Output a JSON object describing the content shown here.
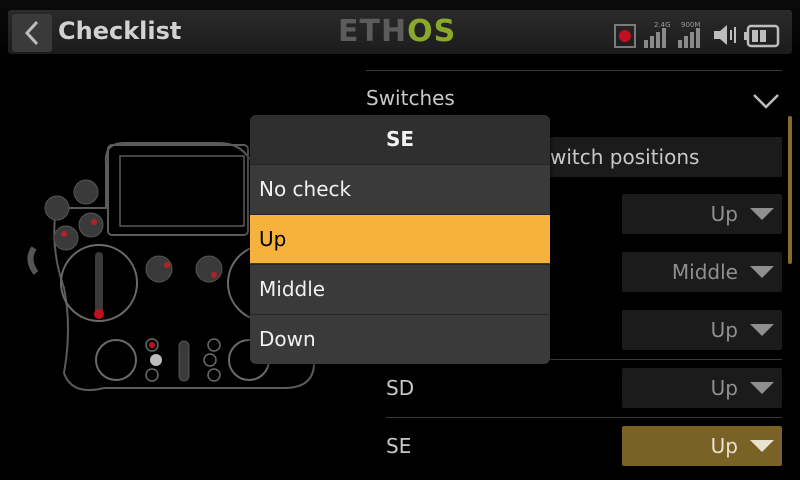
{
  "header": {
    "title": "Checklist",
    "logo_main": "ETH",
    "logo_accent": "OS",
    "signal_24": "2.4G",
    "signal_900": "900M",
    "icons": [
      "back-arrow-icon",
      "record-icon",
      "signal-2-4g-icon",
      "signal-900m-icon",
      "speaker-icon",
      "battery-icon"
    ]
  },
  "section": {
    "label": "Switches",
    "partial_row_text": "witch positions"
  },
  "rows": [
    {
      "label": "",
      "value": "Up"
    },
    {
      "label": "",
      "value": "Middle"
    },
    {
      "label": "",
      "value": "Up"
    },
    {
      "label": "SD",
      "value": "Up"
    },
    {
      "label": "SE",
      "value": "Up",
      "active": true
    }
  ],
  "popup": {
    "title": "SE",
    "options": [
      "No check",
      "Up",
      "Middle",
      "Down"
    ],
    "selected": "Up"
  },
  "colors": {
    "accent": "#f6b23a",
    "active_dropdown": "#7a6125",
    "logo_green": "#8aa92b",
    "background": "#000000"
  }
}
